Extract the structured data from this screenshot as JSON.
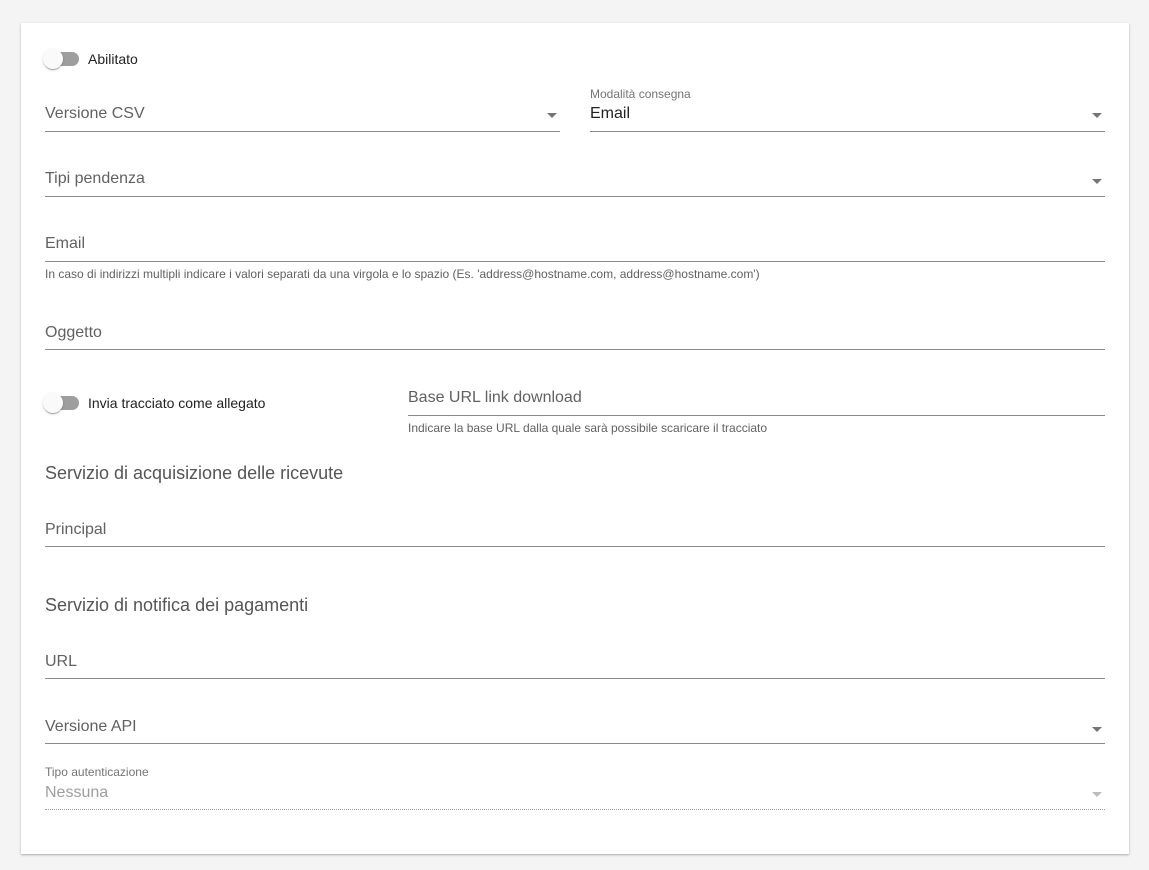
{
  "toggles": {
    "enabled": {
      "label": "Abilitato",
      "on": false
    },
    "attach": {
      "label": "Invia tracciato come allegato",
      "on": false
    }
  },
  "fields": {
    "csv_version": {
      "placeholder": "Versione CSV",
      "icon": "chevron-down-icon"
    },
    "delivery_mode": {
      "label": "Modalità consegna",
      "value": "Email",
      "icon": "chevron-down-icon"
    },
    "pendency_types": {
      "placeholder": "Tipi pendenza",
      "icon": "chevron-down-icon"
    },
    "email": {
      "placeholder": "Email",
      "hint": "In caso di indirizzi multipli indicare i valori separati da una virgola e lo spazio (Es. 'address@hostname.com, address@hostname.com')"
    },
    "subject": {
      "placeholder": "Oggetto"
    },
    "base_url": {
      "placeholder": "Base URL link download",
      "hint": "Indicare la base URL dalla quale sarà possibile scaricare il tracciato"
    },
    "principal": {
      "placeholder": "Principal"
    },
    "url": {
      "placeholder": "URL"
    },
    "api_version": {
      "placeholder": "Versione API",
      "icon": "chevron-down-icon"
    },
    "auth_type": {
      "label": "Tipo autenticazione",
      "value": "Nessuna",
      "icon": "chevron-down-icon",
      "disabled": true
    }
  },
  "sections": {
    "receipts": "Servizio di acquisizione delle ricevute",
    "notifications": "Servizio di notifica dei pagamenti"
  }
}
